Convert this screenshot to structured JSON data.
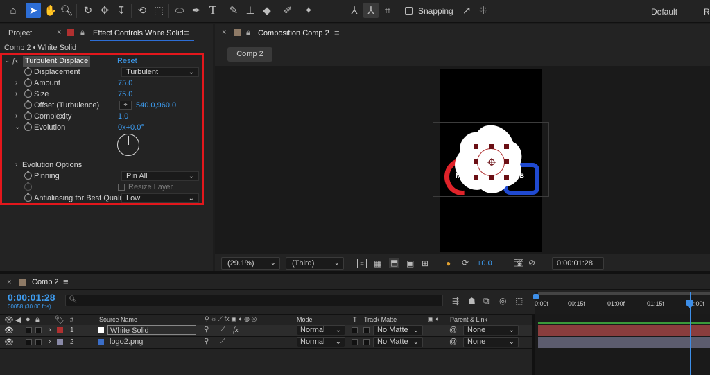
{
  "toolbar": {
    "tools": [
      "home-icon",
      "selection-tool-icon",
      "hand-tool-icon",
      "zoom-tool-icon",
      "orbit-camera-icon",
      "pan-camera-icon",
      "dolly-camera-icon",
      "rotate-tool-icon",
      "pan-behind-icon",
      "ellipse-tool-icon",
      "pen-tool-icon",
      "type-tool-icon",
      "brush-tool-icon",
      "clone-stamp-icon",
      "eraser-icon",
      "roto-brush-icon",
      "puppet-pin-icon"
    ],
    "snapping_label": "Snapping",
    "workspace_default": "Default",
    "workspace_more": "Re"
  },
  "left_panel": {
    "tab_project": "Project",
    "tab_effect_controls": "Effect Controls White Solid",
    "breadcrumb": "Comp 2 • White Solid",
    "effect": {
      "fx_label": "fx",
      "name": "Turbulent Displace",
      "reset": "Reset",
      "displacement_label": "Displacement",
      "displacement_value": "Turbulent",
      "amount_label": "Amount",
      "amount_value": "75.0",
      "size_label": "Size",
      "size_value": "75.0",
      "offset_label": "Offset (Turbulence)",
      "offset_value": "540.0,960.0",
      "complexity_label": "Complexity",
      "complexity_value": "1.0",
      "evolution_label": "Evolution",
      "evolution_value": "0x+0.0°",
      "evolution_options_label": "Evolution Options",
      "pinning_label": "Pinning",
      "pinning_value": "Pin All",
      "resize_layer_label": "Resize Layer",
      "antialiasing_label": "Antialiasing for Best Quali",
      "antialiasing_value": "Low"
    }
  },
  "composition": {
    "tab": "Composition Comp 2",
    "comp_button": "Comp 2",
    "logo_text_left": "M",
    "logo_text_right": "AB",
    "zoom_value": "(29.1%)",
    "view_value": "(Third)",
    "exposure_value": "+0.0",
    "timecode": "0:00:01:28"
  },
  "timeline": {
    "tab": "Comp 2",
    "timecode": "0:00:01:28",
    "frames": "00058 (30.00 fps)",
    "search_placeholder": "",
    "ruler": [
      "0:00f",
      "00:15f",
      "01:00f",
      "01:15f",
      "02:00f"
    ],
    "columns": {
      "number": "#",
      "source_name": "Source Name",
      "mode": "Mode",
      "t": "T",
      "track_matte": "Track Matte",
      "parent_link": "Parent & Link"
    },
    "layers": [
      {
        "num": "1",
        "name": "White Solid",
        "mode": "Normal",
        "matte": "No Matte",
        "parent": "None",
        "label_color": "#b03030",
        "bar_color": "#8a3d3d"
      },
      {
        "num": "2",
        "name": "logo2.png",
        "mode": "Normal",
        "matte": "No Matte",
        "parent": "None",
        "label_color": "#8a8aa8",
        "bar_color": "#5c5c6e"
      }
    ]
  },
  "colors": {
    "accent_blue": "#3d9cf0",
    "highlight_red": "#e3171c",
    "playhead": "#3d8ee8"
  }
}
